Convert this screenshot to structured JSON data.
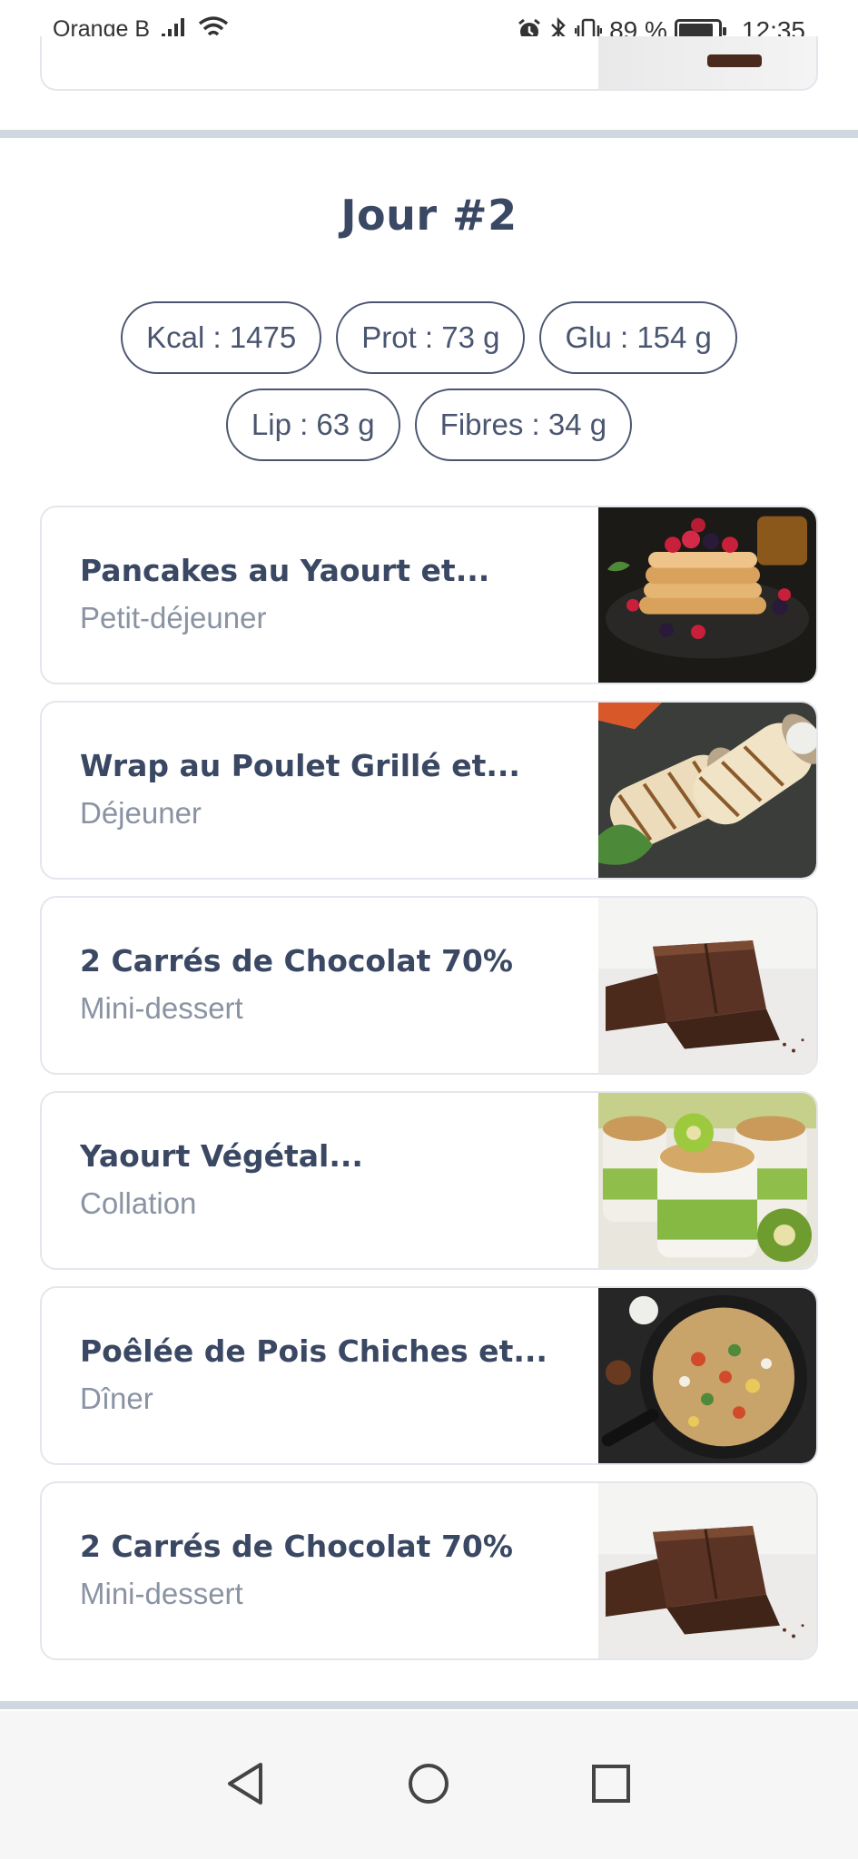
{
  "status_bar": {
    "carrier": "Orange B",
    "battery_text": "89 %",
    "battery_level": 0.89,
    "time": "12:35",
    "icons": [
      "signal-icon",
      "wifi-icon",
      "alarm-icon",
      "bluetooth-icon",
      "vibrate-icon",
      "battery-icon"
    ]
  },
  "day": {
    "title": "Jour #2",
    "nutrients": [
      {
        "label": "Kcal : 1475"
      },
      {
        "label": "Prot : 73 g"
      },
      {
        "label": "Glu : 154 g"
      },
      {
        "label": "Lip : 63 g"
      },
      {
        "label": "Fibres : 34 g"
      }
    ]
  },
  "meals": [
    {
      "title": "Pancakes au Yaourt et...",
      "type": "Petit-déjeuner",
      "image": "pancakes-image"
    },
    {
      "title": "Wrap au Poulet Grillé et...",
      "type": "Déjeuner",
      "image": "wrap-image"
    },
    {
      "title": "2 Carrés de Chocolat 70%",
      "type": "Mini-dessert",
      "image": "chocolate-image"
    },
    {
      "title": "Yaourt Végétal...",
      "type": "Collation",
      "image": "yogurt-kiwi-image"
    },
    {
      "title": "Poêlée de Pois Chiches et...",
      "type": "Dîner",
      "image": "chickpea-pan-image"
    },
    {
      "title": "2 Carrés de Chocolat 70%",
      "type": "Mini-dessert",
      "image": "chocolate-image"
    }
  ],
  "nav": {
    "icons": [
      "back-icon",
      "home-icon",
      "recents-icon"
    ]
  },
  "colors": {
    "primary_text": "#3a4863",
    "secondary_text": "#8a93a3",
    "divider": "#cfd7e0",
    "chip_border": "#4a5670"
  }
}
